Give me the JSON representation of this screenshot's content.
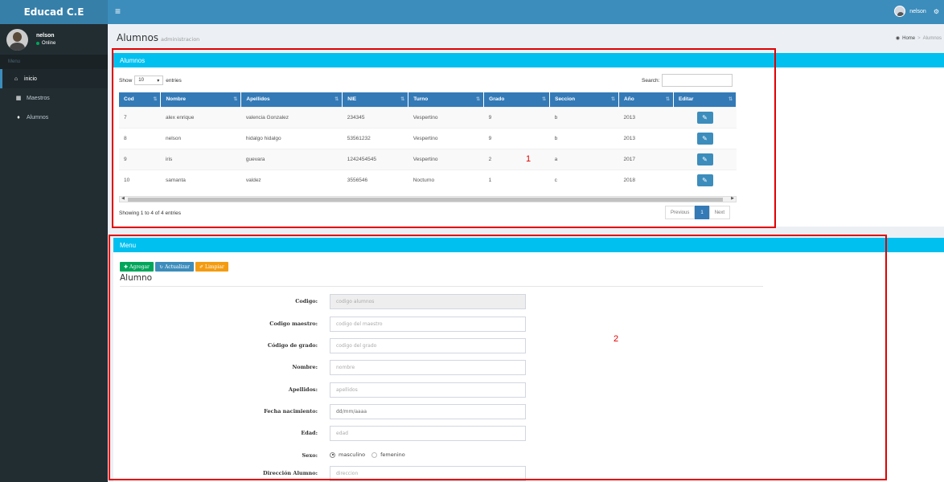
{
  "app": {
    "title": "Educad C.E"
  },
  "topbar": {
    "menu_icon": "hamburger-icon",
    "user_name": "nelson",
    "settings_icon": "gear-icon"
  },
  "sidebar": {
    "user": {
      "name": "nelson",
      "status": "Online"
    },
    "menu_header": "Menu",
    "items": [
      {
        "label": "inicio",
        "icon": "home-icon",
        "glyph": "✦"
      },
      {
        "label": "Maestros",
        "icon": "teachers-icon",
        "glyph": "▦"
      },
      {
        "label": "Alumnos",
        "icon": "student-icon",
        "glyph": "♦"
      }
    ]
  },
  "page": {
    "title": "Alumnos",
    "subtitle": "administracion"
  },
  "breadcrumb": {
    "home": "Home",
    "current": "Alumnos"
  },
  "table_box": {
    "title": "Alumnos",
    "show_label": "Show",
    "entries_value": "10",
    "entries_label": "entries",
    "search_label": "Search:",
    "columns": [
      "Cod",
      "Nombre",
      "Apellidos",
      "NIE",
      "Turno",
      "Grado",
      "Seccion",
      "Año",
      "Editar"
    ],
    "rows": [
      [
        "7",
        "alex enrique",
        "valencia Gonzalez",
        "234345",
        "Vespertino",
        "9",
        "b",
        "2013"
      ],
      [
        "8",
        "nelson",
        "hidalgo hidalgo",
        "53561232",
        "Vespertino",
        "9",
        "b",
        "2013"
      ],
      [
        "9",
        "iris",
        "guevara",
        "1242454545",
        "Vespertino",
        "2",
        "a",
        "2017"
      ],
      [
        "10",
        "samanta",
        "valdez",
        "3556546",
        "Nocturno",
        "1",
        "c",
        "2018"
      ]
    ],
    "info": "Showing 1 to 4 of 4 entries",
    "pagination": {
      "previous": "Previous",
      "current": "1",
      "next": "Next"
    }
  },
  "form_box": {
    "title": "Menu",
    "buttons": {
      "add": "Agregar",
      "update": "Actualizar",
      "clear": "Limpiar"
    },
    "form_title": "Alumno",
    "fields": [
      {
        "label": "Codigo:",
        "placeholder": "codigo alumnos"
      },
      {
        "label": "Codigo maestro:",
        "placeholder": "codigo del maestro"
      },
      {
        "label": "Código de grado:",
        "placeholder": "codigo del grado"
      },
      {
        "label": "Nombre:",
        "placeholder": "nombre"
      },
      {
        "label": "Apellidos:",
        "placeholder": "apellidos"
      },
      {
        "label": "Fecha nacimiento:",
        "placeholder": "dd/mm/aaaa"
      },
      {
        "label": "Edad:",
        "placeholder": "edad"
      }
    ],
    "sexo": {
      "label": "Sexo:",
      "option_male": "masculino",
      "option_female": "femenino",
      "selected": "masculino"
    },
    "address": {
      "label": "Dirección Alumno:",
      "placeholder": "direccion"
    }
  },
  "annotations": {
    "box1_label": "1",
    "box2_label": "2",
    "color": "#e00000"
  }
}
